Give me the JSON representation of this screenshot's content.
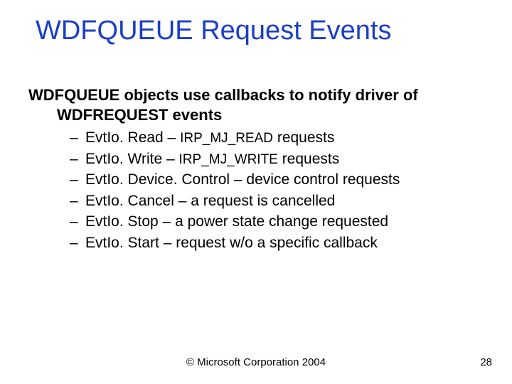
{
  "title": "WDFQUEUE Request Events",
  "lead": {
    "line1": "WDFQUEUE objects use callbacks to notify driver of",
    "line2": "WDFREQUEST events"
  },
  "bullets": [
    {
      "pre": "EvtIo. Read – ",
      "code": "IRP_MJ_READ",
      "post": " requests"
    },
    {
      "pre": "EvtIo. Write – ",
      "code": "IRP_MJ_WRITE",
      "post": " requests"
    },
    {
      "pre": "EvtIo. Device. Control – device control requests",
      "code": "",
      "post": ""
    },
    {
      "pre": "EvtIo. Cancel – a request is cancelled",
      "code": "",
      "post": ""
    },
    {
      "pre": "EvtIo. Stop – a power state change requested",
      "code": "",
      "post": ""
    },
    {
      "pre": "EvtIo. Start – request w/o a specific callback",
      "code": "",
      "post": ""
    }
  ],
  "footer": {
    "copyright": "© Microsoft Corporation 2004",
    "page": "28"
  },
  "dash": "–  "
}
